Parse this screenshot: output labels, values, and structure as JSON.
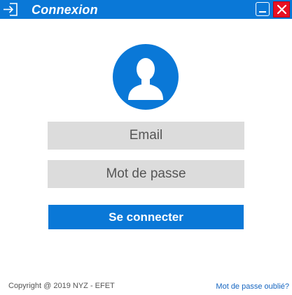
{
  "window": {
    "title": "Connexion",
    "title_icon": "login-arrow-icon",
    "controls": {
      "minimize_icon": "minimize-icon",
      "close_icon": "close-icon"
    }
  },
  "avatar": {
    "icon": "user-avatar-icon"
  },
  "form": {
    "email_placeholder": "Email",
    "password_placeholder": "Mot de passe",
    "submit_label": "Se connecter"
  },
  "footer": {
    "copyright": "Copyright @ 2019 NYZ - EFET",
    "forgot_password": "Mot de passe oublié?"
  },
  "colors": {
    "accent": "#0a78d7",
    "close_button": "#e81123",
    "field_background": "#dcdcdc",
    "link": "#1565c0"
  }
}
